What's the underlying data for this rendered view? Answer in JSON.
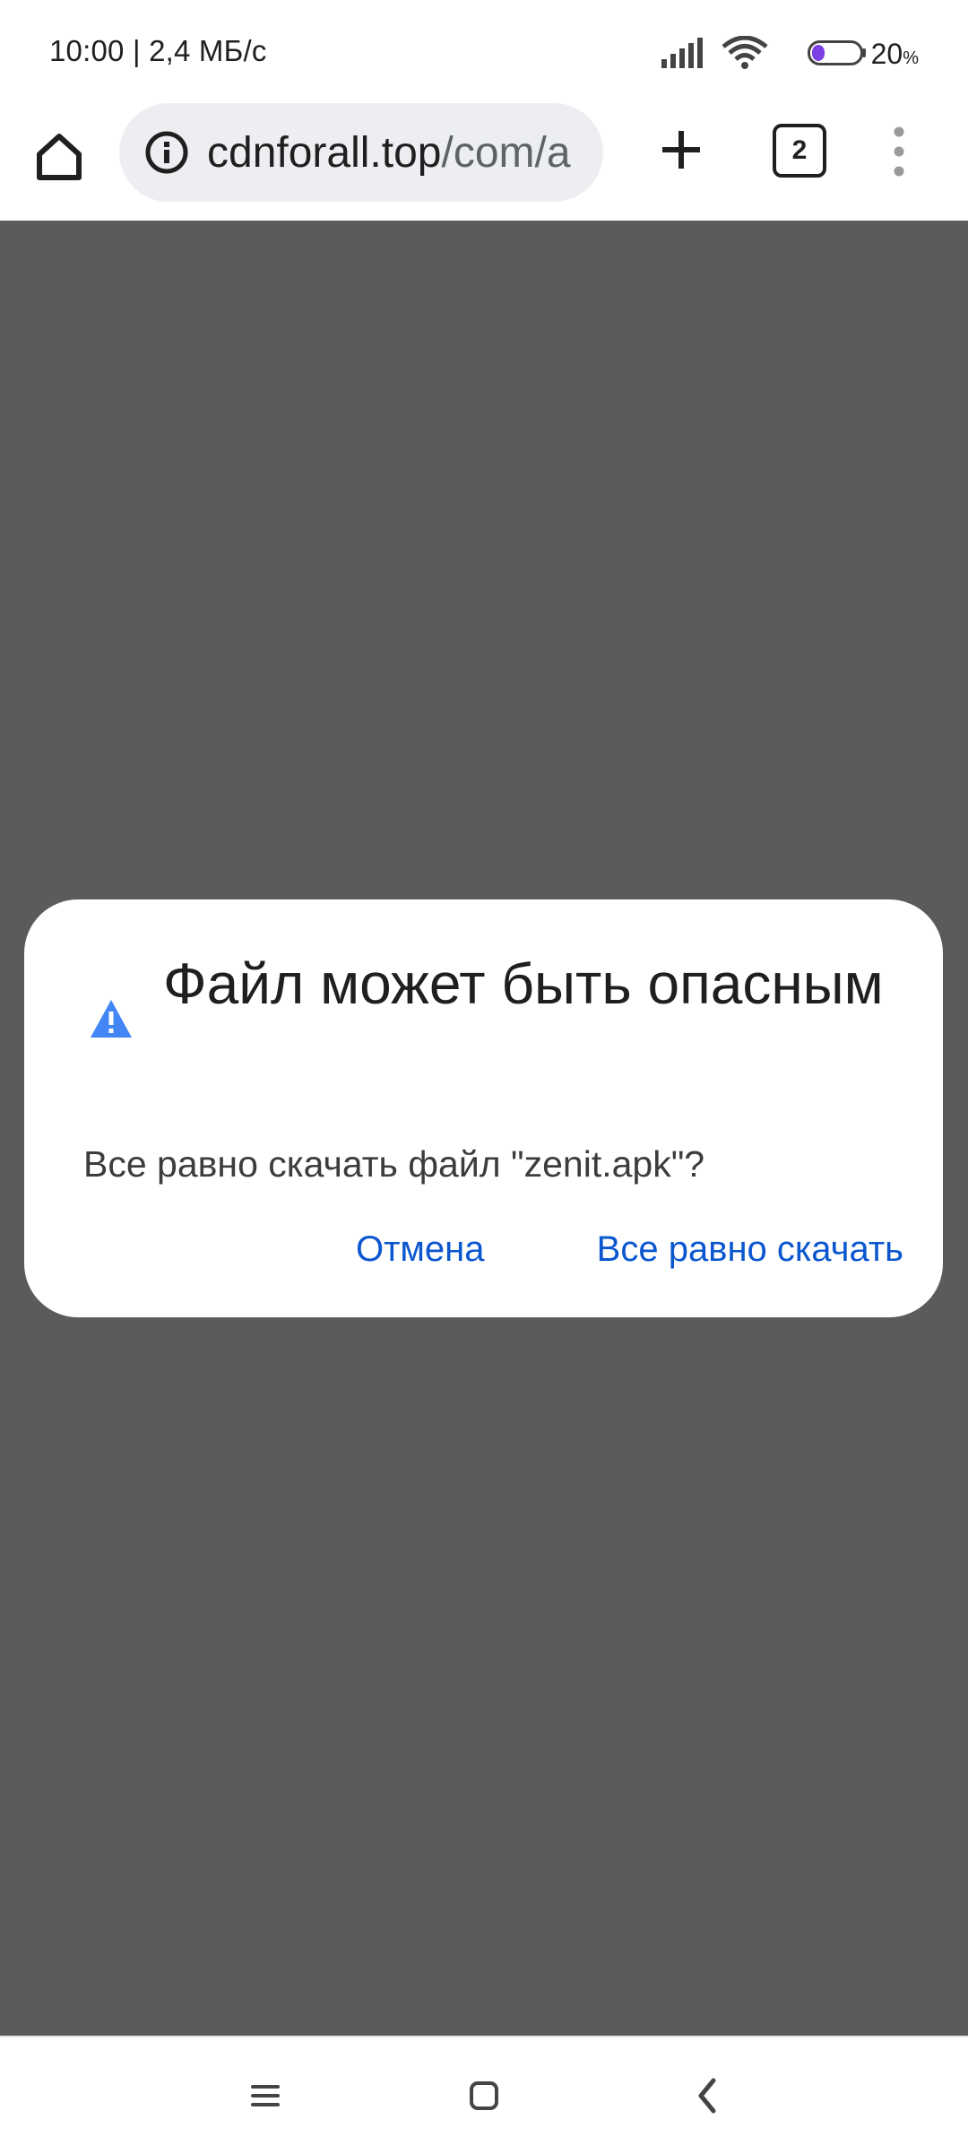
{
  "status_bar": {
    "time_speed": "10:00 | 2,4 МБ/с",
    "battery_value": "20",
    "battery_unit": "%",
    "battery_level": 0.2,
    "icons": [
      "signal-icon",
      "wifi-icon",
      "battery-icon"
    ]
  },
  "toolbar": {
    "url_host": "cdnforall.top",
    "url_path": "/com/a",
    "tab_count": "2",
    "icons": [
      "home-icon",
      "info-icon",
      "plus-icon",
      "tab-switcher-icon",
      "more-vert-icon"
    ]
  },
  "dialog": {
    "title": "Файл может быть опасным",
    "message": "Все равно скачать файл \"zenit.apk\"?",
    "cancel_label": "Отмена",
    "download_label": "Все равно скачать",
    "icon": "warning-icon"
  },
  "nav_bar": {
    "icons": [
      "recents-icon",
      "home-square-icon",
      "back-icon"
    ]
  },
  "colors": {
    "accent": "#0b57d0",
    "warning_icon": "#4285f4",
    "scrim": "#5b5b5b",
    "omnibox_bg": "#eceef1",
    "battery_fill": "#7b3fe4"
  }
}
